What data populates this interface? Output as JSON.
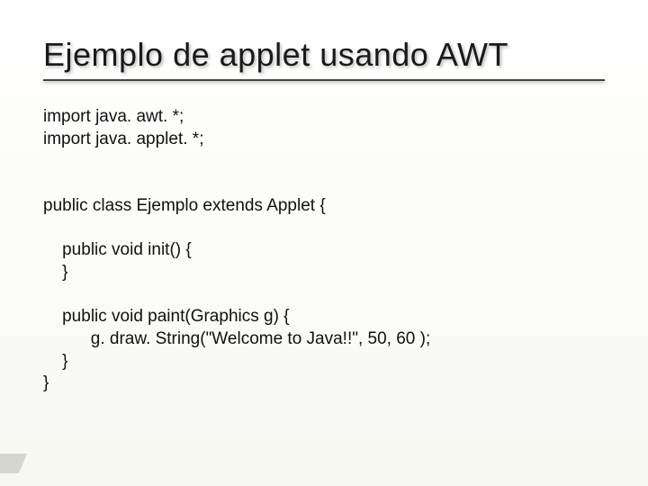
{
  "slide": {
    "title": "Ejemplo de applet usando AWT",
    "code": "import java. awt. *;\nimport java. applet. *;\n\n\npublic class Ejemplo extends Applet {\n\n    public void init() {\n    }\n\n    public void paint(Graphics g) {\n          g. draw. String(\"Welcome to Java!!\", 50, 60 );\n    }\n}"
  }
}
